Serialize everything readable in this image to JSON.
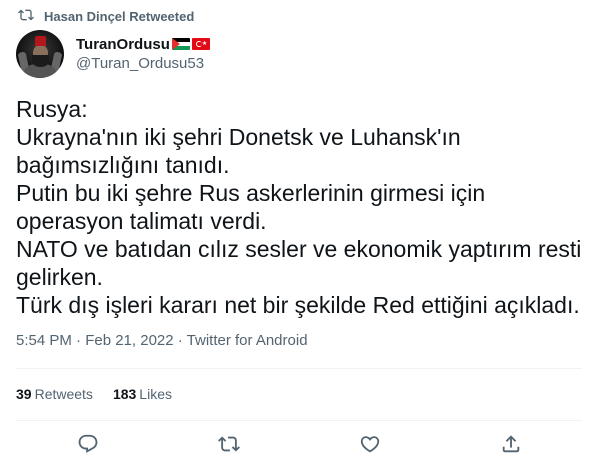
{
  "social_context": {
    "label": "Hasan Dinçel Retweeted",
    "icon": "retweet-icon"
  },
  "author": {
    "display_name": "TuranOrdusu",
    "handle": "@Turan_Ordusu53",
    "badges": [
      "palestine-flag",
      "turkey-flag"
    ]
  },
  "tweet": {
    "lines": [
      "Rusya:",
      "Ukrayna'nın iki şehri Donetsk ve Luhansk'ın",
      "bağımsızlığını tanıdı.",
      "Putin bu iki şehre Rus askerlerinin girmesi için",
      "operasyon talimatı verdi.",
      "NATO ve batıdan cılız sesler ve ekonomik yaptırım resti",
      "gelirken.",
      "Türk dış işleri kararı net bir şekilde Red ettiğini açıkladı."
    ]
  },
  "meta": {
    "text": "5:54 PM · Feb 21, 2022 · Twitter for Android"
  },
  "stats": {
    "retweets": {
      "count": "39",
      "label": "Retweets"
    },
    "likes": {
      "count": "183",
      "label": "Likes"
    }
  },
  "actions": [
    "reply-icon",
    "retweet-icon",
    "like-icon",
    "share-icon"
  ],
  "colors": {
    "text": "#0f1419",
    "secondary": "#536471",
    "divider": "#eff3f4"
  }
}
